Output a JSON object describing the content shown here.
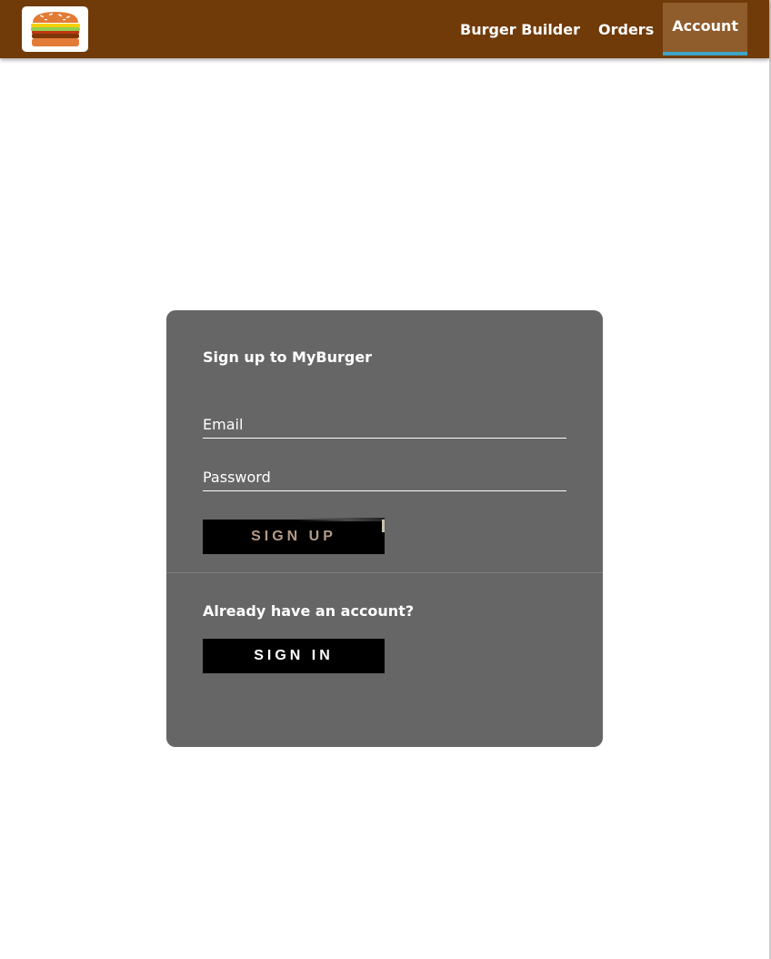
{
  "header": {
    "logo_icon": "burger-logo-icon",
    "nav": [
      {
        "label": "Burger Builder",
        "active": false
      },
      {
        "label": "Orders",
        "active": false
      },
      {
        "label": "Account",
        "active": true
      }
    ]
  },
  "auth": {
    "title": "Sign up to MyBurger",
    "email_placeholder": "Email",
    "password_placeholder": "Password",
    "signup_label": "SIGN UP",
    "signin_prompt": "Already have an account?",
    "signin_label": "SIGN IN"
  },
  "colors": {
    "toolbar": "#703B09",
    "active_tab": "#8F5C2C",
    "active_underline": "#40A4C8",
    "card": "#666666",
    "button": "#000000",
    "signup_text": "#B39A85"
  }
}
